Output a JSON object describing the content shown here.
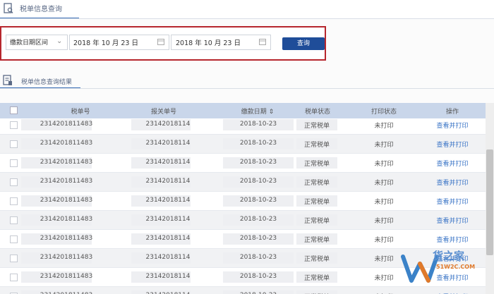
{
  "header": {
    "title": "税单信息查询"
  },
  "query": {
    "date_type": "缴款日期区间",
    "start_date": "2018 年 10 月 23 日",
    "end_date": "2018 年 10 月 23 日",
    "button_label": "查询"
  },
  "results": {
    "tab_label": "税单信息查询结果",
    "columns": [
      "税单号",
      "报关单号",
      "缴款日期 ⇕",
      "税单状态",
      "打印状态",
      "操作"
    ],
    "rows": [
      {
        "tax_no": "2314201811483",
        "decl_no": "23142018114",
        "date": "2018-10-23",
        "status": "正常税单",
        "print": "未打印",
        "op": "查看并打印"
      },
      {
        "tax_no": "2314201811483",
        "decl_no": "23142018114",
        "date": "2018-10-23",
        "status": "正常税单",
        "print": "未打印",
        "op": "查看并打印"
      },
      {
        "tax_no": "2314201811483",
        "decl_no": "23142018114",
        "date": "2018-10-23",
        "status": "正常税单",
        "print": "未打印",
        "op": "查看并打印"
      },
      {
        "tax_no": "2314201811483",
        "decl_no": "23142018114",
        "date": "2018-10-23",
        "status": "正常税单",
        "print": "未打印",
        "op": "查看并打印"
      },
      {
        "tax_no": "2314201811483",
        "decl_no": "23142018114",
        "date": "2018-10-23",
        "status": "正常税单",
        "print": "未打印",
        "op": "查看并打印"
      },
      {
        "tax_no": "2314201811483",
        "decl_no": "23142018114",
        "date": "2018-10-23",
        "status": "正常税单",
        "print": "未打印",
        "op": "查看并打印"
      },
      {
        "tax_no": "2314201811483",
        "decl_no": "23142018114",
        "date": "2018-10-23",
        "status": "正常税单",
        "print": "未打印",
        "op": "查看并打印"
      },
      {
        "tax_no": "2314201811483",
        "decl_no": "23142018114",
        "date": "2018-10-23",
        "status": "正常税单",
        "print": "未打印",
        "op": "查看并打印"
      },
      {
        "tax_no": "2314201811483",
        "decl_no": "23142018114",
        "date": "2018-10-23",
        "status": "正常税单",
        "print": "未打印",
        "op": "查看并打印"
      },
      {
        "tax_no": "2314201811483",
        "decl_no": "23142018114",
        "date": "2018-10-23",
        "status": "正常税单",
        "print": "未打印",
        "op": "查看并打印"
      }
    ]
  },
  "watermark": {
    "title": "货之家",
    "subtitle": "51W2C.COM"
  },
  "colors": {
    "accent": "#1f4d99",
    "highlight_border": "#b6262d",
    "link": "#3a74c6",
    "table_header": "#c9d6ea"
  },
  "icons": {
    "page": "document-search-icon",
    "results": "document-list-icon",
    "calendar": "calendar-icon",
    "select": "chevron-down-icon"
  }
}
